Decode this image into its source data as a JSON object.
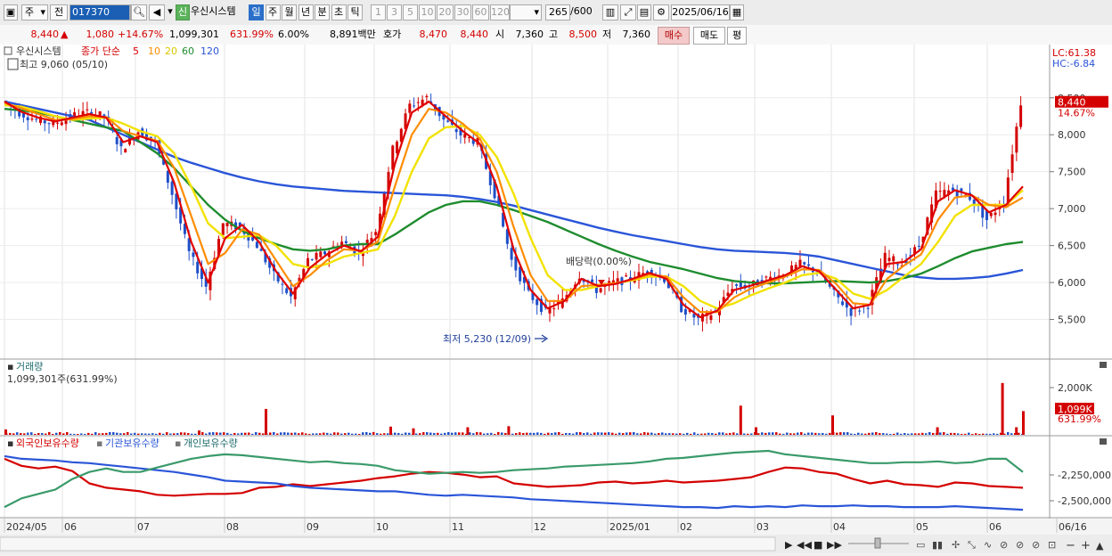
{
  "toolbar": {
    "market_label": "주",
    "prev_label": "전",
    "code": "017370",
    "new_badge": "신",
    "stock_name": "우신시스템",
    "period_tabs": [
      "일",
      "주",
      "월",
      "년",
      "분",
      "초",
      "틱"
    ],
    "interval_buttons": [
      "1",
      "3",
      "5",
      "10",
      "20",
      "30",
      "60",
      "120"
    ],
    "count": "265",
    "count_total": "/600",
    "date": "2025/06/16"
  },
  "quote": {
    "price": "8,440",
    "arrow": "▲",
    "change": "1,080",
    "change_pct": "+14.67%",
    "volume": "1,099,301",
    "volume_pct": "631.99%",
    "turnover_pct": "6.00%",
    "amount": "8,891백만",
    "ask_label": "호가",
    "ask1": "8,470",
    "ask2": "8,440",
    "open_label": "시",
    "open": "7,360",
    "high_label": "고",
    "high": "8,500",
    "low_label": "저",
    "low": "7,360",
    "buy_button": "매수",
    "sell_button": "매도",
    "eval_button": "평"
  },
  "price_panel": {
    "title": "우신시스템",
    "ma_label": "종가 단순",
    "ma_periods": [
      "5",
      "10",
      "20",
      "60",
      "120"
    ],
    "high_note": "최고 9,060 (05/10)",
    "low_note": "최저 5,230 (12/09)",
    "dividend_note": "배당락(0.00%)",
    "lc_label": "LC:61.38",
    "hc_label": "HC:-6.84",
    "last_price": "8,440",
    "last_pct": "14.67%"
  },
  "volume_panel": {
    "title": "거래량",
    "value_note": "1,099,301주(631.99%)",
    "last_value": "1,099K",
    "last_pct": "631.99%"
  },
  "holdings_panel": {
    "series_labels": [
      "외국인보유수량",
      "기관보유수량",
      "개인보유수량"
    ]
  },
  "colors": {
    "up": "#d40000",
    "down": "#1f4fc8",
    "ma5": "#e00000",
    "ma10": "#ff8c00",
    "ma20": "#f2e200",
    "ma60": "#1e8c2e",
    "ma120": "#2a55d8",
    "foreign": "#d40000",
    "institution": "#2a55d8",
    "individual": "#3a9a6a"
  },
  "chart_data": [
    {
      "type": "line",
      "title": "우신시스템",
      "x_labels": [
        "2024/05",
        "06",
        "07",
        "08",
        "09",
        "10",
        "11",
        "12",
        "2025/01",
        "02",
        "03",
        "04",
        "05",
        "06",
        "06/16"
      ],
      "y_ticks": [
        "5,500",
        "6,000",
        "6,500",
        "7,000",
        "7,500",
        "8,000",
        "8,500"
      ],
      "ylim": [
        5000,
        9100
      ],
      "series": [
        {
          "name": "종가",
          "values": [
            8450,
            8300,
            8200,
            8150,
            8250,
            8300,
            8250,
            7800,
            8050,
            7900,
            7200,
            6400,
            5950,
            6800,
            6750,
            6500,
            6100,
            5800,
            6300,
            6400,
            6550,
            6400,
            6700,
            7800,
            8400,
            8500,
            8200,
            8000,
            7900,
            7200,
            6300,
            5850,
            5600,
            5750,
            6100,
            5900,
            6000,
            6050,
            6150,
            6050,
            5650,
            5500,
            5600,
            5950,
            5950,
            6050,
            6100,
            6250,
            6150,
            5850,
            5600,
            5700,
            6350,
            6250,
            6500,
            7200,
            7250,
            7150,
            6850,
            7100,
            8440
          ]
        },
        {
          "name": "5",
          "values": [
            8450,
            8310,
            8230,
            8180,
            8230,
            8280,
            8230,
            7900,
            7980,
            7900,
            7350,
            6550,
            6000,
            6600,
            6780,
            6550,
            6150,
            5850,
            6200,
            6380,
            6500,
            6420,
            6620,
            7600,
            8300,
            8450,
            8250,
            8050,
            7880,
            7300,
            6450,
            5900,
            5650,
            5750,
            6050,
            5950,
            5980,
            6050,
            6130,
            6050,
            5700,
            5530,
            5620,
            5900,
            5960,
            6030,
            6100,
            6220,
            6150,
            5900,
            5650,
            5700,
            6250,
            6280,
            6450,
            7100,
            7250,
            7180,
            6950,
            7050,
            7300
          ]
        },
        {
          "name": "10",
          "values": [
            8430,
            8360,
            8280,
            8200,
            8210,
            8250,
            8240,
            8050,
            7980,
            7920,
            7550,
            6900,
            6250,
            6400,
            6720,
            6650,
            6300,
            5950,
            6100,
            6300,
            6450,
            6430,
            6550,
            7300,
            8000,
            8350,
            8300,
            8150,
            7950,
            7500,
            6750,
            6100,
            5750,
            5750,
            5950,
            5970,
            5990,
            6040,
            6110,
            6080,
            5800,
            5600,
            5600,
            5800,
            5920,
            6000,
            6080,
            6180,
            6170,
            5980,
            5720,
            5700,
            6050,
            6230,
            6380,
            6850,
            7150,
            7180,
            7050,
            7020,
            7150
          ]
        },
        {
          "name": "20",
          "values": [
            8400,
            8380,
            8320,
            8250,
            8200,
            8220,
            8230,
            8150,
            8050,
            7980,
            7750,
            7300,
            6800,
            6600,
            6620,
            6640,
            6500,
            6250,
            6200,
            6250,
            6350,
            6400,
            6450,
            6900,
            7500,
            7950,
            8100,
            8120,
            8000,
            7700,
            7200,
            6600,
            6100,
            5900,
            5900,
            5950,
            5990,
            6030,
            6080,
            6080,
            5950,
            5750,
            5650,
            5720,
            5830,
            5920,
            6000,
            6100,
            6130,
            6050,
            5850,
            5780,
            5900,
            6080,
            6250,
            6550,
            6900,
            7050,
            7050,
            7050,
            7250
          ]
        },
        {
          "name": "60",
          "values": [
            8350,
            8330,
            8300,
            8250,
            8200,
            8150,
            8100,
            8050,
            7900,
            7750,
            7550,
            7300,
            7050,
            6850,
            6700,
            6600,
            6520,
            6450,
            6430,
            6450,
            6500,
            6520,
            6520,
            6650,
            6800,
            6950,
            7050,
            7100,
            7100,
            7050,
            6980,
            6900,
            6820,
            6720,
            6620,
            6520,
            6430,
            6350,
            6280,
            6230,
            6180,
            6120,
            6060,
            6020,
            6000,
            5990,
            5990,
            6000,
            6010,
            6020,
            6010,
            6000,
            6020,
            6060,
            6120,
            6220,
            6330,
            6420,
            6470,
            6520,
            6550
          ]
        },
        {
          "name": "120",
          "values": [
            8450,
            8400,
            8350,
            8300,
            8250,
            8200,
            8100,
            8000,
            7900,
            7800,
            7700,
            7620,
            7550,
            7480,
            7420,
            7370,
            7330,
            7300,
            7280,
            7260,
            7240,
            7230,
            7220,
            7210,
            7200,
            7190,
            7180,
            7160,
            7130,
            7090,
            7040,
            6980,
            6920,
            6860,
            6800,
            6740,
            6690,
            6640,
            6600,
            6560,
            6520,
            6480,
            6450,
            6430,
            6420,
            6410,
            6400,
            6380,
            6350,
            6300,
            6250,
            6200,
            6150,
            6100,
            6070,
            6050,
            6050,
            6060,
            6080,
            6120,
            6170
          ]
        }
      ],
      "annotations": [
        "최고 9,060 (05/10)",
        "최저 5,230 (12/09)",
        "배당락(0.00%)"
      ]
    },
    {
      "type": "bar",
      "title": "거래량",
      "y_ticks": [
        "2,000K"
      ],
      "ylim": [
        0,
        2600
      ],
      "spikes": [
        {
          "month_pos": 0.0,
          "value": 250
        },
        {
          "month_pos": 2.7,
          "value": 200
        },
        {
          "month_pos": 3.5,
          "value": 1200
        },
        {
          "month_pos": 5.2,
          "value": 380
        },
        {
          "month_pos": 5.5,
          "value": 300
        },
        {
          "month_pos": 6.2,
          "value": 350
        },
        {
          "month_pos": 6.7,
          "value": 400
        },
        {
          "month_pos": 9.8,
          "value": 1350
        },
        {
          "month_pos": 10.0,
          "value": 350
        },
        {
          "month_pos": 11.0,
          "value": 900
        },
        {
          "month_pos": 12.3,
          "value": 350
        },
        {
          "month_pos": 13.2,
          "value": 2400
        },
        {
          "month_pos": 13.4,
          "value": 350
        },
        {
          "month_pos": 13.5,
          "value": 1099
        }
      ]
    },
    {
      "type": "line",
      "title": "",
      "y_ticks": [
        "-2,250,000",
        "-2,500,000"
      ],
      "series": [
        {
          "name": "외국인보유수량",
          "values": [
            -2150,
            -2230,
            -2260,
            -2240,
            -2290,
            -2430,
            -2480,
            -2500,
            -2520,
            -2560,
            -2570,
            -2560,
            -2550,
            -2550,
            -2540,
            -2480,
            -2470,
            -2440,
            -2460,
            -2440,
            -2420,
            -2400,
            -2370,
            -2350,
            -2320,
            -2300,
            -2310,
            -2330,
            -2360,
            -2350,
            -2430,
            -2450,
            -2470,
            -2460,
            -2450,
            -2420,
            -2410,
            -2430,
            -2420,
            -2400,
            -2420,
            -2410,
            -2400,
            -2380,
            -2360,
            -2300,
            -2250,
            -2260,
            -2300,
            -2320,
            -2380,
            -2430,
            -2400,
            -2440,
            -2450,
            -2470,
            -2420,
            -2430,
            -2460,
            -2470,
            -2480
          ]
        },
        {
          "name": "기관보유수량",
          "values": [
            -2120,
            -2150,
            -2160,
            -2170,
            -2190,
            -2200,
            -2220,
            -2240,
            -2260,
            -2280,
            -2300,
            -2330,
            -2360,
            -2400,
            -2410,
            -2420,
            -2430,
            -2460,
            -2480,
            -2490,
            -2500,
            -2510,
            -2520,
            -2520,
            -2540,
            -2560,
            -2570,
            -2560,
            -2570,
            -2580,
            -2590,
            -2610,
            -2620,
            -2630,
            -2640,
            -2650,
            -2660,
            -2670,
            -2680,
            -2690,
            -2700,
            -2700,
            -2710,
            -2690,
            -2700,
            -2690,
            -2700,
            -2680,
            -2690,
            -2690,
            -2680,
            -2690,
            -2690,
            -2700,
            -2700,
            -2700,
            -2690,
            -2700,
            -2710,
            -2720,
            -2730
          ]
        },
        {
          "name": "개인보유수량",
          "values": [
            -2700,
            -2600,
            -2550,
            -2500,
            -2380,
            -2300,
            -2260,
            -2300,
            -2300,
            -2250,
            -2200,
            -2150,
            -2120,
            -2100,
            -2110,
            -2130,
            -2150,
            -2170,
            -2190,
            -2180,
            -2200,
            -2210,
            -2230,
            -2280,
            -2300,
            -2320,
            -2310,
            -2300,
            -2310,
            -2300,
            -2280,
            -2270,
            -2260,
            -2240,
            -2230,
            -2220,
            -2210,
            -2200,
            -2180,
            -2150,
            -2140,
            -2120,
            -2100,
            -2080,
            -2070,
            -2060,
            -2100,
            -2120,
            -2140,
            -2160,
            -2180,
            -2200,
            -2200,
            -2190,
            -2190,
            -2180,
            -2200,
            -2190,
            -2150,
            -2150,
            -2300
          ]
        }
      ]
    }
  ]
}
